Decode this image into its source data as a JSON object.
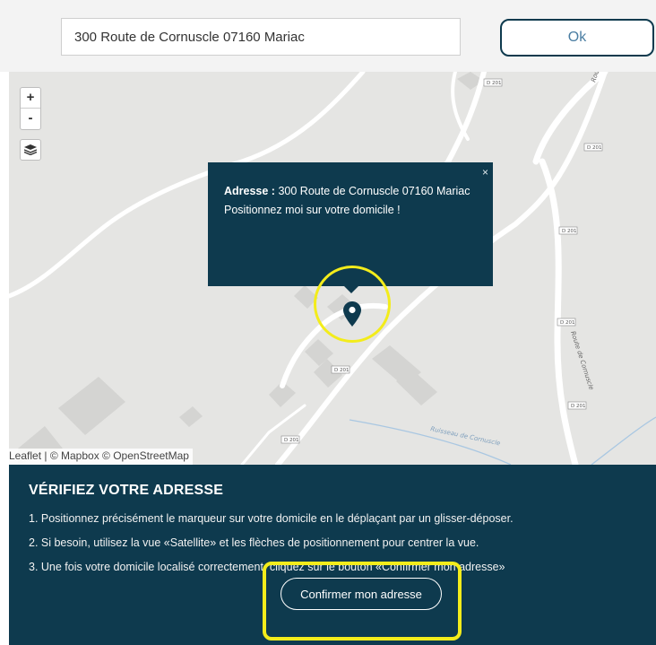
{
  "search": {
    "value": "300 Route de Cornuscle 07160 Mariac",
    "ok_label": "Ok"
  },
  "map": {
    "zoom_in": "+",
    "zoom_out": "-",
    "layers_icon": "layers-icon",
    "road_labels": [
      "D 201",
      "D 201",
      "D 201",
      "D 201",
      "D 201",
      "D 201",
      "D 201"
    ],
    "street_labels": [
      "Route de Cornuscle",
      "Route de Cornuscle"
    ],
    "stream_label": "Ruisseau de Cornuscle",
    "popup": {
      "label": "Adresse :",
      "address": " 300 Route de Cornuscle 07160 Mariac",
      "message": "Positionnez moi sur votre domicile !",
      "close": "×"
    },
    "marker_icon": "map-pin-icon",
    "attribution": {
      "leaflet": "Leaflet",
      "mapbox": "© Mapbox",
      "osm": "© OpenStreetMap"
    },
    "highlight_color": "#f3ec1b"
  },
  "panel": {
    "title": "VÉRIFIEZ VOTRE ADRESSE",
    "steps": [
      "1. Positionnez précisément le marqueur sur votre domicile en le déplaçant par un glisser-déposer.",
      "2. Si besoin, utilisez la vue «Satellite» et les flèches de positionnement pour centrer la vue.",
      "3. Une fois votre domicile localisé correctement, cliquez sur le bouton «Confirmer mon adresse»"
    ],
    "confirm_label": "Confirmer mon adresse"
  },
  "colors": {
    "brand": "#0e3a4e",
    "highlight": "#f3ec1b"
  }
}
